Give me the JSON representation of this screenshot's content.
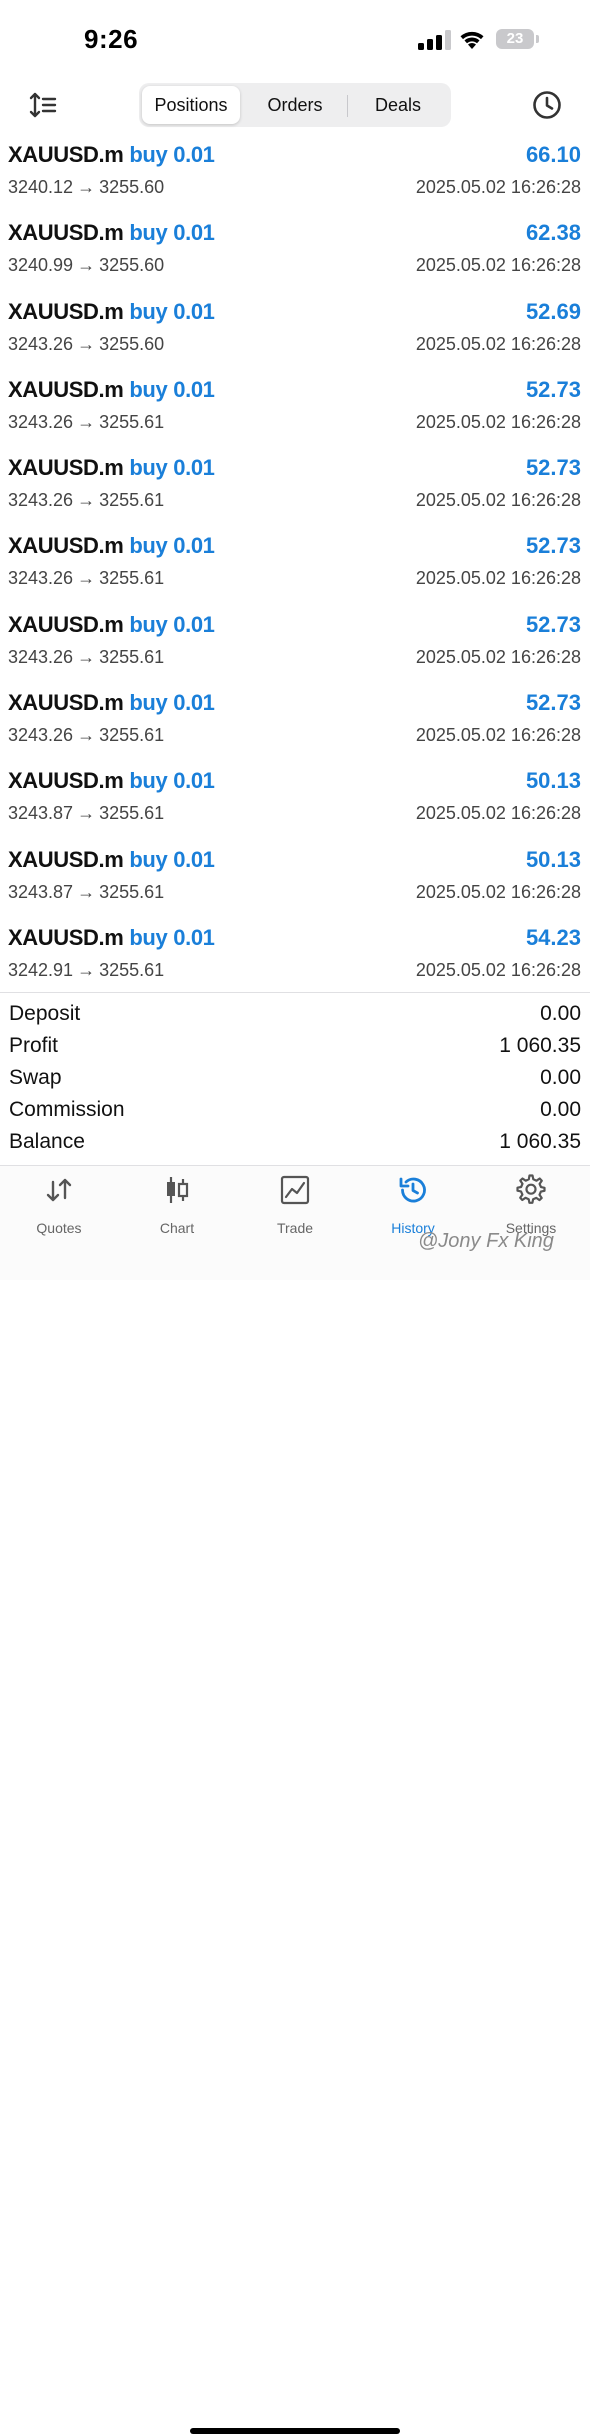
{
  "status_bar": {
    "time": "9:26",
    "battery": "23"
  },
  "header": {
    "tabs": [
      {
        "label": "Positions",
        "active": true
      },
      {
        "label": "Orders",
        "active": false
      },
      {
        "label": "Deals",
        "active": false
      }
    ]
  },
  "deals": [
    {
      "symbol": "XAUUSD.m",
      "direction": "buy",
      "volume": "0.01",
      "profit": "66.10",
      "open_price": "3240.12",
      "close_price": "3255.60",
      "time": "2025.05.02 16:26:28"
    },
    {
      "symbol": "XAUUSD.m",
      "direction": "buy",
      "volume": "0.01",
      "profit": "62.38",
      "open_price": "3240.99",
      "close_price": "3255.60",
      "time": "2025.05.02 16:26:28"
    },
    {
      "symbol": "XAUUSD.m",
      "direction": "buy",
      "volume": "0.01",
      "profit": "52.69",
      "open_price": "3243.26",
      "close_price": "3255.60",
      "time": "2025.05.02 16:26:28"
    },
    {
      "symbol": "XAUUSD.m",
      "direction": "buy",
      "volume": "0.01",
      "profit": "52.73",
      "open_price": "3243.26",
      "close_price": "3255.61",
      "time": "2025.05.02 16:26:28"
    },
    {
      "symbol": "XAUUSD.m",
      "direction": "buy",
      "volume": "0.01",
      "profit": "52.73",
      "open_price": "3243.26",
      "close_price": "3255.61",
      "time": "2025.05.02 16:26:28"
    },
    {
      "symbol": "XAUUSD.m",
      "direction": "buy",
      "volume": "0.01",
      "profit": "52.73",
      "open_price": "3243.26",
      "close_price": "3255.61",
      "time": "2025.05.02 16:26:28"
    },
    {
      "symbol": "XAUUSD.m",
      "direction": "buy",
      "volume": "0.01",
      "profit": "52.73",
      "open_price": "3243.26",
      "close_price": "3255.61",
      "time": "2025.05.02 16:26:28"
    },
    {
      "symbol": "XAUUSD.m",
      "direction": "buy",
      "volume": "0.01",
      "profit": "52.73",
      "open_price": "3243.26",
      "close_price": "3255.61",
      "time": "2025.05.02 16:26:28"
    },
    {
      "symbol": "XAUUSD.m",
      "direction": "buy",
      "volume": "0.01",
      "profit": "50.13",
      "open_price": "3243.87",
      "close_price": "3255.61",
      "time": "2025.05.02 16:26:28"
    },
    {
      "symbol": "XAUUSD.m",
      "direction": "buy",
      "volume": "0.01",
      "profit": "50.13",
      "open_price": "3243.87",
      "close_price": "3255.61",
      "time": "2025.05.02 16:26:28"
    },
    {
      "symbol": "XAUUSD.m",
      "direction": "buy",
      "volume": "0.01",
      "profit": "54.23",
      "open_price": "3242.91",
      "close_price": "3255.61",
      "time": "2025.05.02 16:26:28"
    }
  ],
  "summary": [
    {
      "label": "Deposit",
      "value": "0.00"
    },
    {
      "label": "Profit",
      "value": "1 060.35"
    },
    {
      "label": "Swap",
      "value": "0.00"
    },
    {
      "label": "Commission",
      "value": "0.00"
    },
    {
      "label": "Balance",
      "value": "1 060.35"
    }
  ],
  "tabbar": [
    {
      "label": "Quotes",
      "icon": "quotes-icon",
      "active": false
    },
    {
      "label": "Chart",
      "icon": "chart-icon",
      "active": false
    },
    {
      "label": "Trade",
      "icon": "trade-icon",
      "active": false
    },
    {
      "label": "History",
      "icon": "history-icon",
      "active": true
    },
    {
      "label": "Settings",
      "icon": "gear-icon",
      "active": false
    }
  ],
  "watermark": "@Jony Fx King",
  "colors": {
    "accent": "#1a7fd9",
    "text": "#111111",
    "muted": "#444444"
  }
}
